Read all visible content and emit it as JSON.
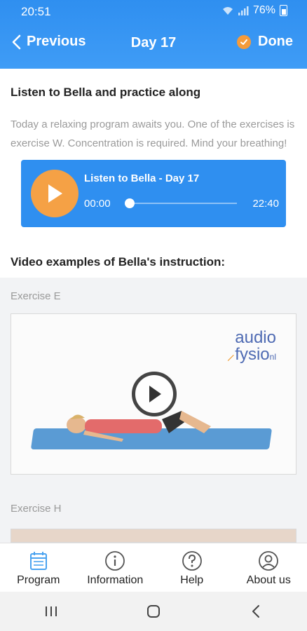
{
  "status": {
    "time": "20:51",
    "battery_text": "76%"
  },
  "nav": {
    "prev_label": "Previous",
    "title": "Day 17",
    "done_label": "Done"
  },
  "intro": {
    "heading": "Listen to Bella and practice along",
    "text": "Today a relaxing program awaits you. One of the exercises is exercise W. Concentration is required. Mind your breathing!"
  },
  "player": {
    "title": "Listen to Bella - Day 17",
    "current_time": "00:00",
    "duration": "22:40",
    "progress": 0
  },
  "videos": {
    "heading": "Video examples of Bella's instruction:",
    "items": [
      {
        "label": "Exercise E",
        "logo_line1": "audio",
        "logo_line2": "fysio",
        "logo_suffix": "nl"
      },
      {
        "label": "Exercise H"
      }
    ]
  },
  "tabs": [
    {
      "label": "Program",
      "icon": "calendar-icon",
      "active": true
    },
    {
      "label": "Information",
      "icon": "info-icon",
      "active": false
    },
    {
      "label": "Help",
      "icon": "help-icon",
      "active": false
    },
    {
      "label": "About us",
      "icon": "user-icon",
      "active": false
    }
  ],
  "colors": {
    "primary": "#2f8ff0",
    "accent": "#f5a145"
  }
}
